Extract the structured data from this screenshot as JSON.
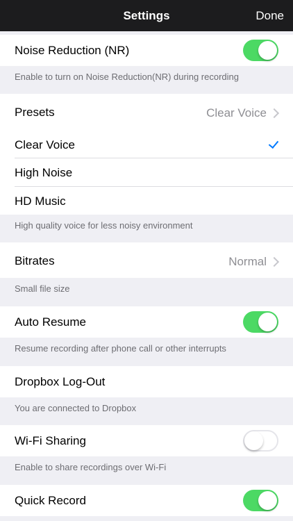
{
  "nav": {
    "title": "Settings",
    "done_label": "Done"
  },
  "noise_reduction": {
    "label": "Noise Reduction (NR)",
    "enabled": true,
    "footer": "Enable to turn on Noise Reduction(NR) during recording"
  },
  "presets": {
    "label": "Presets",
    "value": "Clear Voice",
    "options": [
      {
        "label": "Clear Voice",
        "selected": true
      },
      {
        "label": "High Noise",
        "selected": false
      },
      {
        "label": "HD Music",
        "selected": false
      }
    ],
    "footer": "High quality voice for less noisy environment"
  },
  "bitrates": {
    "label": "Bitrates",
    "value": "Normal",
    "footer": "Small file size"
  },
  "auto_resume": {
    "label": "Auto Resume",
    "enabled": true,
    "footer": "Resume recording after phone call or other interrupts"
  },
  "dropbox": {
    "label": "Dropbox Log-Out",
    "footer": "You are connected to Dropbox"
  },
  "wifi_sharing": {
    "label": "Wi-Fi Sharing",
    "enabled": false,
    "footer": "Enable to share recordings over Wi-Fi"
  },
  "quick_record": {
    "label": "Quick Record",
    "enabled": true
  },
  "colors": {
    "switch_on": "#4cd964",
    "checkmark": "#007aff",
    "navbar": "#1c1c1e"
  },
  "icons": {
    "chevron": "chevron-right-icon",
    "check": "checkmark-icon"
  }
}
